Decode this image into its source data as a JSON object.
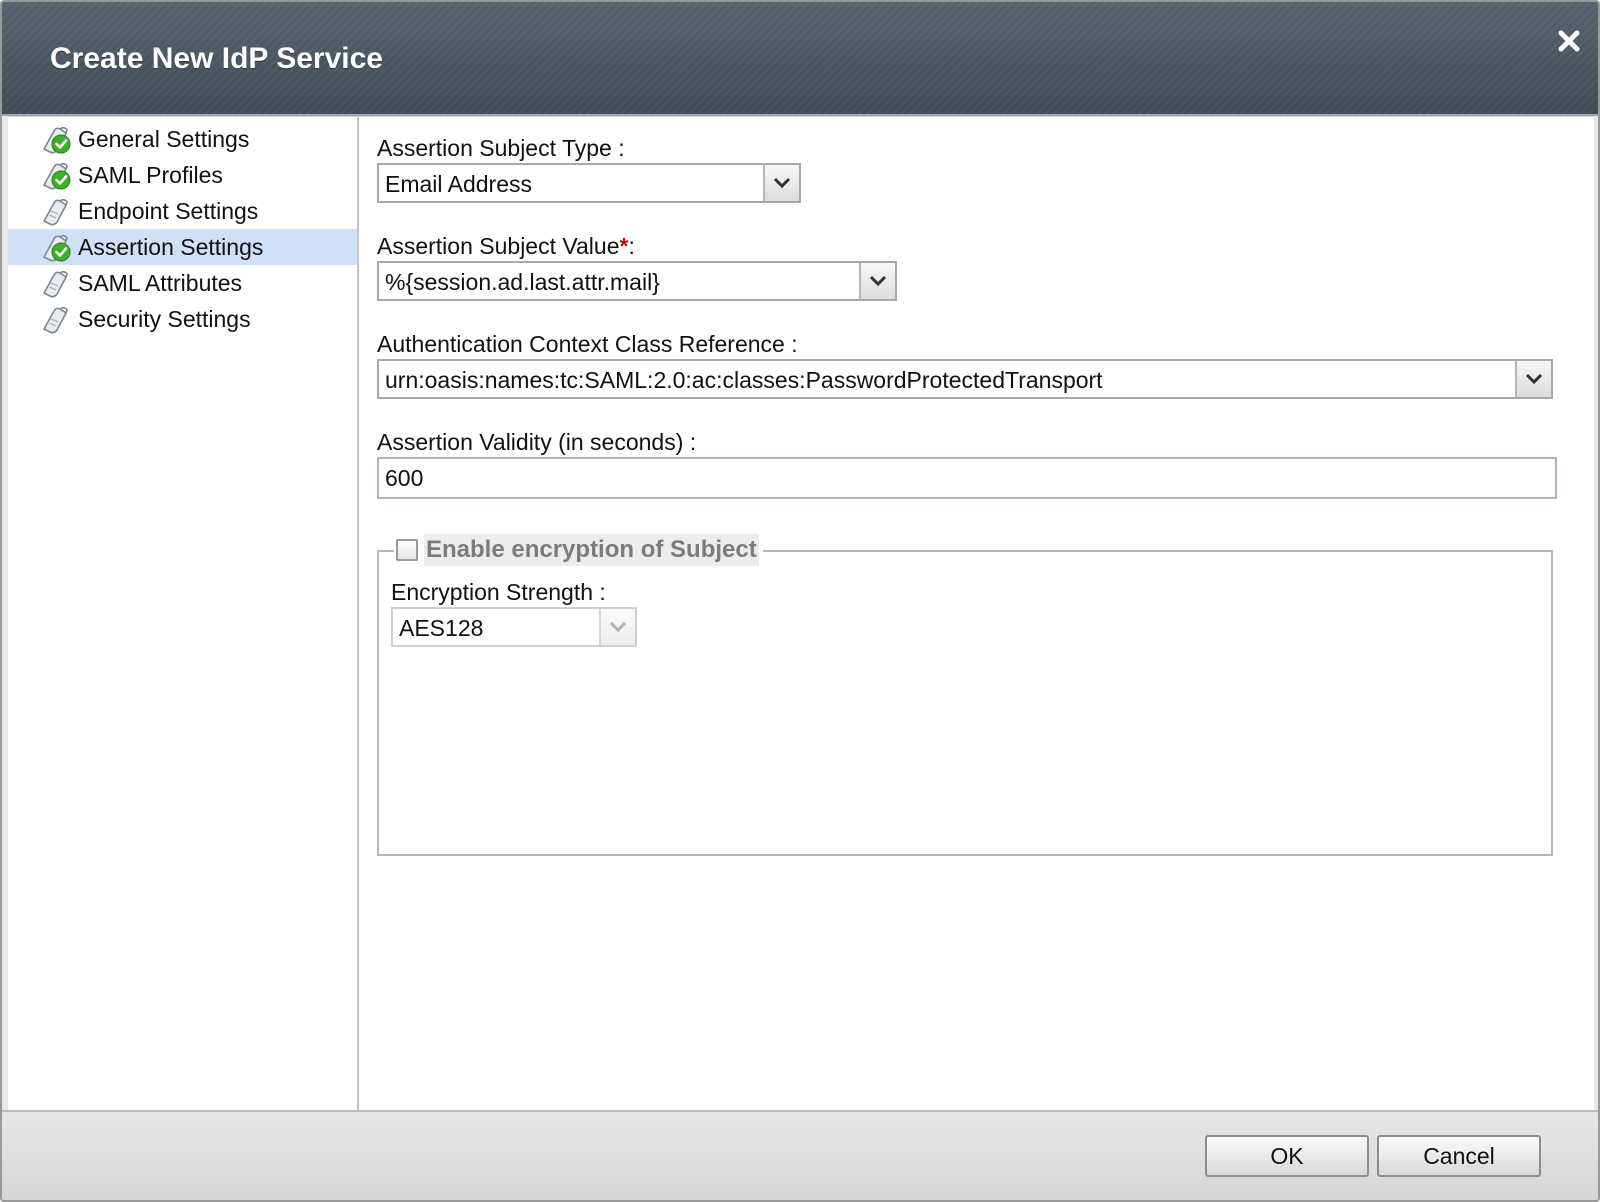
{
  "dialog": {
    "title": "Create New IdP Service",
    "close_icon": "close-icon"
  },
  "nav": {
    "items": [
      {
        "label": "General Settings",
        "icon": "check-doc-icon",
        "status": "complete"
      },
      {
        "label": "SAML Profiles",
        "icon": "check-doc-icon",
        "status": "complete"
      },
      {
        "label": "Endpoint Settings",
        "icon": "doc-icon",
        "status": "pending"
      },
      {
        "label": "Assertion Settings",
        "icon": "check-doc-icon",
        "status": "complete",
        "selected": true
      },
      {
        "label": "SAML Attributes",
        "icon": "doc-icon",
        "status": "pending"
      },
      {
        "label": "Security Settings",
        "icon": "doc-icon",
        "status": "pending"
      }
    ]
  },
  "form": {
    "subject_type": {
      "label": "Assertion Subject Type :",
      "value": "Email Address"
    },
    "subject_value": {
      "label": "Assertion Subject Value",
      "required_mark": "*",
      "suffix": ":",
      "value": "%{session.ad.last.attr.mail}"
    },
    "auth_context": {
      "label": "Authentication Context Class Reference :",
      "value": "urn:oasis:names:tc:SAML:2.0:ac:classes:PasswordProtectedTransport"
    },
    "validity": {
      "label": "Assertion Validity (in seconds) :",
      "value": "600"
    },
    "encryption": {
      "legend": "Enable encryption of Subject",
      "enabled": false,
      "strength": {
        "label": "Encryption Strength :",
        "value": "AES128",
        "disabled": true
      }
    }
  },
  "footer": {
    "ok_label": "OK",
    "cancel_label": "Cancel"
  },
  "colors": {
    "titlebar": "#4b5865",
    "nav_selected": "#cfe0f7",
    "required": "#b3121b",
    "check_green": "#3fae2a"
  }
}
